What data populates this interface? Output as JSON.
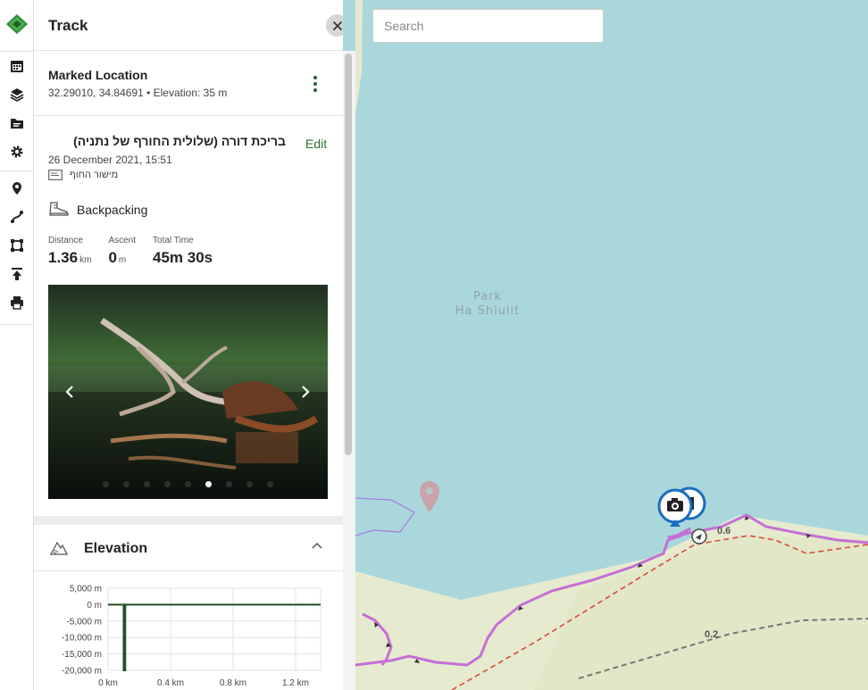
{
  "panel": {
    "title": "Track",
    "marked": {
      "title": "Marked Location",
      "coords": "32.29010, 34.84691 • Elevation: 35 m"
    },
    "track": {
      "name": "בריכת דורה (שלולית החורף של נתניה)",
      "edit_label": "Edit",
      "date": "26 December 2021, 15:51",
      "note": "מישור החוף",
      "activity": "Backpacking",
      "stats": [
        {
          "label": "Distance",
          "value": "1.36",
          "unit": "km"
        },
        {
          "label": "Ascent",
          "value": "0",
          "unit": "m"
        },
        {
          "label": "Total Time",
          "value": "45m 30s",
          "unit": ""
        }
      ],
      "photo_dots": 9,
      "active_photo": 5
    },
    "elevation": {
      "title": "Elevation"
    }
  },
  "search": {
    "placeholder": "Search"
  },
  "map": {
    "place_label_1": "Park",
    "place_label_2": "Ha Shlulit",
    "km_labels": [
      "0.6",
      "0.2"
    ]
  },
  "chart_data": {
    "type": "line",
    "title": "",
    "xlabel": "",
    "ylabel": "",
    "y_ticks": [
      "5,000 m",
      "0 m",
      "-5,000 m",
      "-10,000 m",
      "-15,000 m",
      "-20,000 m"
    ],
    "x_ticks": [
      "0 km",
      "0.4 km",
      "0.8 km",
      "1.2 km"
    ],
    "ylim": [
      -20000,
      5000
    ],
    "xlim": [
      0,
      1.36
    ],
    "series": [
      {
        "x": [
          0,
          0.1,
          0.1,
          0.11,
          0.11,
          1.36
        ],
        "values": [
          0,
          0,
          -20000,
          -20000,
          0,
          0
        ]
      }
    ],
    "colors": {
      "line": "#1f4f22"
    }
  },
  "colors": {
    "accent": "#2c6d2f",
    "track": "#c66fd6",
    "water": "#aad7db",
    "land": "#e6ebcf"
  }
}
